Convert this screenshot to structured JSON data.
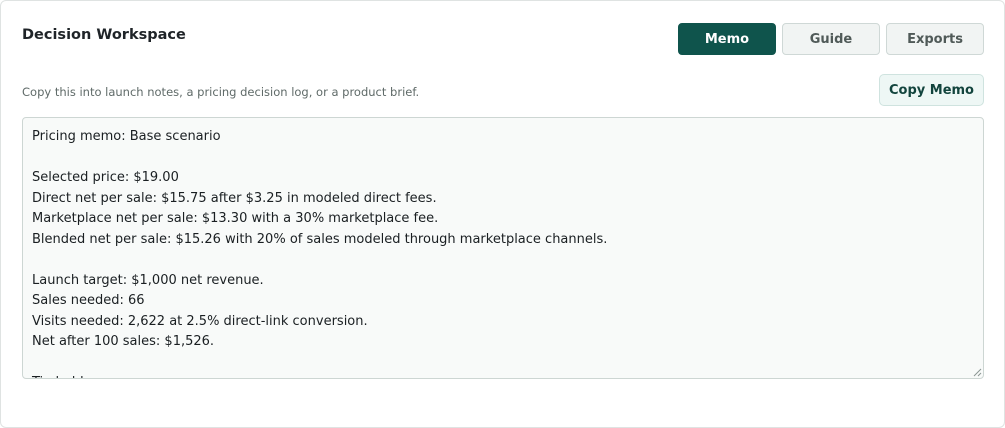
{
  "workspace": {
    "title": "Decision Workspace",
    "subtitle": "Copy this into launch notes, a pricing decision log, or a product brief."
  },
  "tabs": [
    {
      "label": "Memo",
      "active": true
    },
    {
      "label": "Guide",
      "active": false
    },
    {
      "label": "Exports",
      "active": false
    }
  ],
  "copy_button": {
    "label": "Copy Memo"
  },
  "memo": {
    "lines": [
      "Pricing memo: Base scenario",
      "",
      "Selected price: $19.00",
      "Direct net per sale: $15.75 after $3.25 in modeled direct fees.",
      "Marketplace net per sale: $13.30 with a 30% marketplace fee.",
      "Blended net per sale: $15.26 with 20% of sales modeled through marketplace channels.",
      "",
      "Launch target: $1,000 net revenue.",
      "Sales needed: 66",
      "Visits needed: 2,622 at 2.5% direct-link conversion.",
      "Net after 100 sales: $1,526.",
      "",
      "Tip ladder:"
    ]
  },
  "colors": {
    "accent": "#0f544c",
    "tab_inactive_bg": "#f1f4f3",
    "memo_bg": "#f8faf9",
    "copy_button_bg": "#eef7f5"
  }
}
